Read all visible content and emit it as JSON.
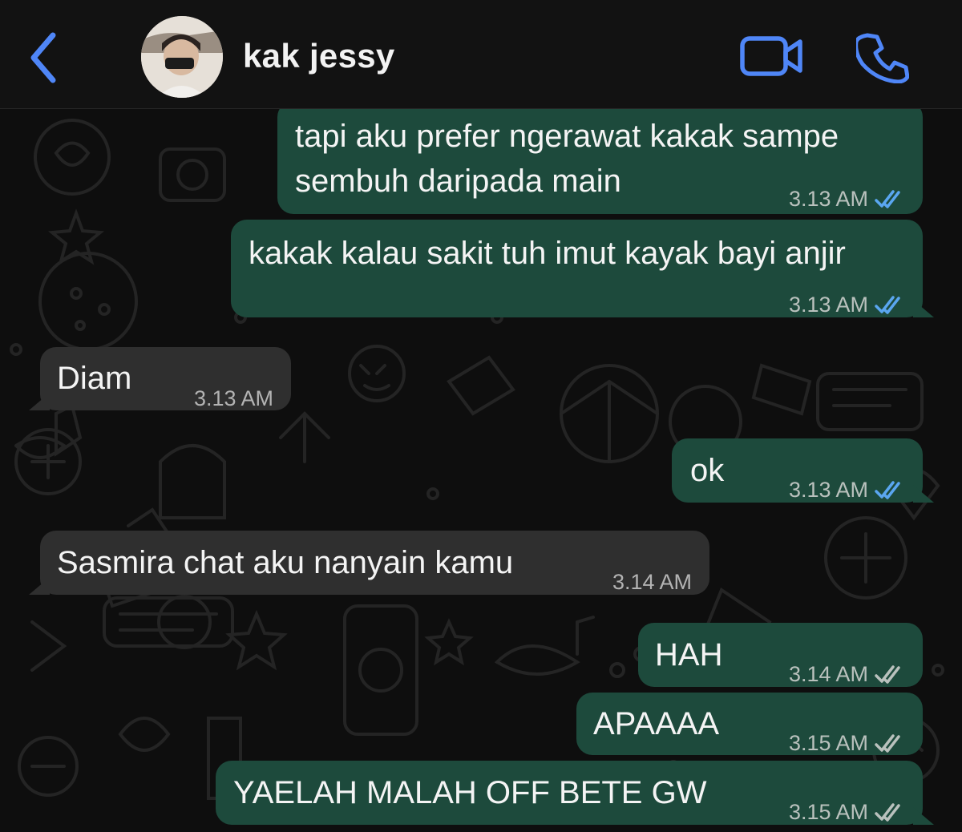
{
  "header": {
    "back_icon": "chevron-left-icon",
    "contact_name": "kak jessy",
    "video_icon": "video-camera-icon",
    "call_icon": "phone-icon",
    "accent_color": "#4f86f7"
  },
  "messages": [
    {
      "direction": "out",
      "lines": [
        "tapi aku prefer ngerawat kakak sampe",
        "sembuh daripada main"
      ],
      "time": "3.13 AM",
      "status": "read"
    },
    {
      "direction": "out",
      "lines": [
        "kakak kalau sakit tuh imut kayak bayi anjir"
      ],
      "time": "3.13 AM",
      "status": "read"
    },
    {
      "direction": "in",
      "lines": [
        "Diam"
      ],
      "time": "3.13 AM"
    },
    {
      "direction": "out",
      "lines": [
        "ok"
      ],
      "time": "3.13 AM",
      "status": "read"
    },
    {
      "direction": "in",
      "lines": [
        "Sasmira chat aku nanyain kamu"
      ],
      "time": "3.14 AM"
    },
    {
      "direction": "out",
      "lines": [
        "HAH"
      ],
      "time": "3.14 AM",
      "status": "delivered"
    },
    {
      "direction": "out",
      "lines": [
        "APAAAA"
      ],
      "time": "3.15 AM",
      "status": "delivered"
    },
    {
      "direction": "out",
      "lines": [
        "YAELAH MALAH OFF BETE GW"
      ],
      "time": "3.15 AM",
      "status": "delivered"
    }
  ],
  "colors": {
    "outgoing_bubble": "#1d4a3c",
    "incoming_bubble": "#2f2f2f",
    "read_ticks": "#5aa6f0",
    "delivered_ticks": "#b9c1bd"
  }
}
